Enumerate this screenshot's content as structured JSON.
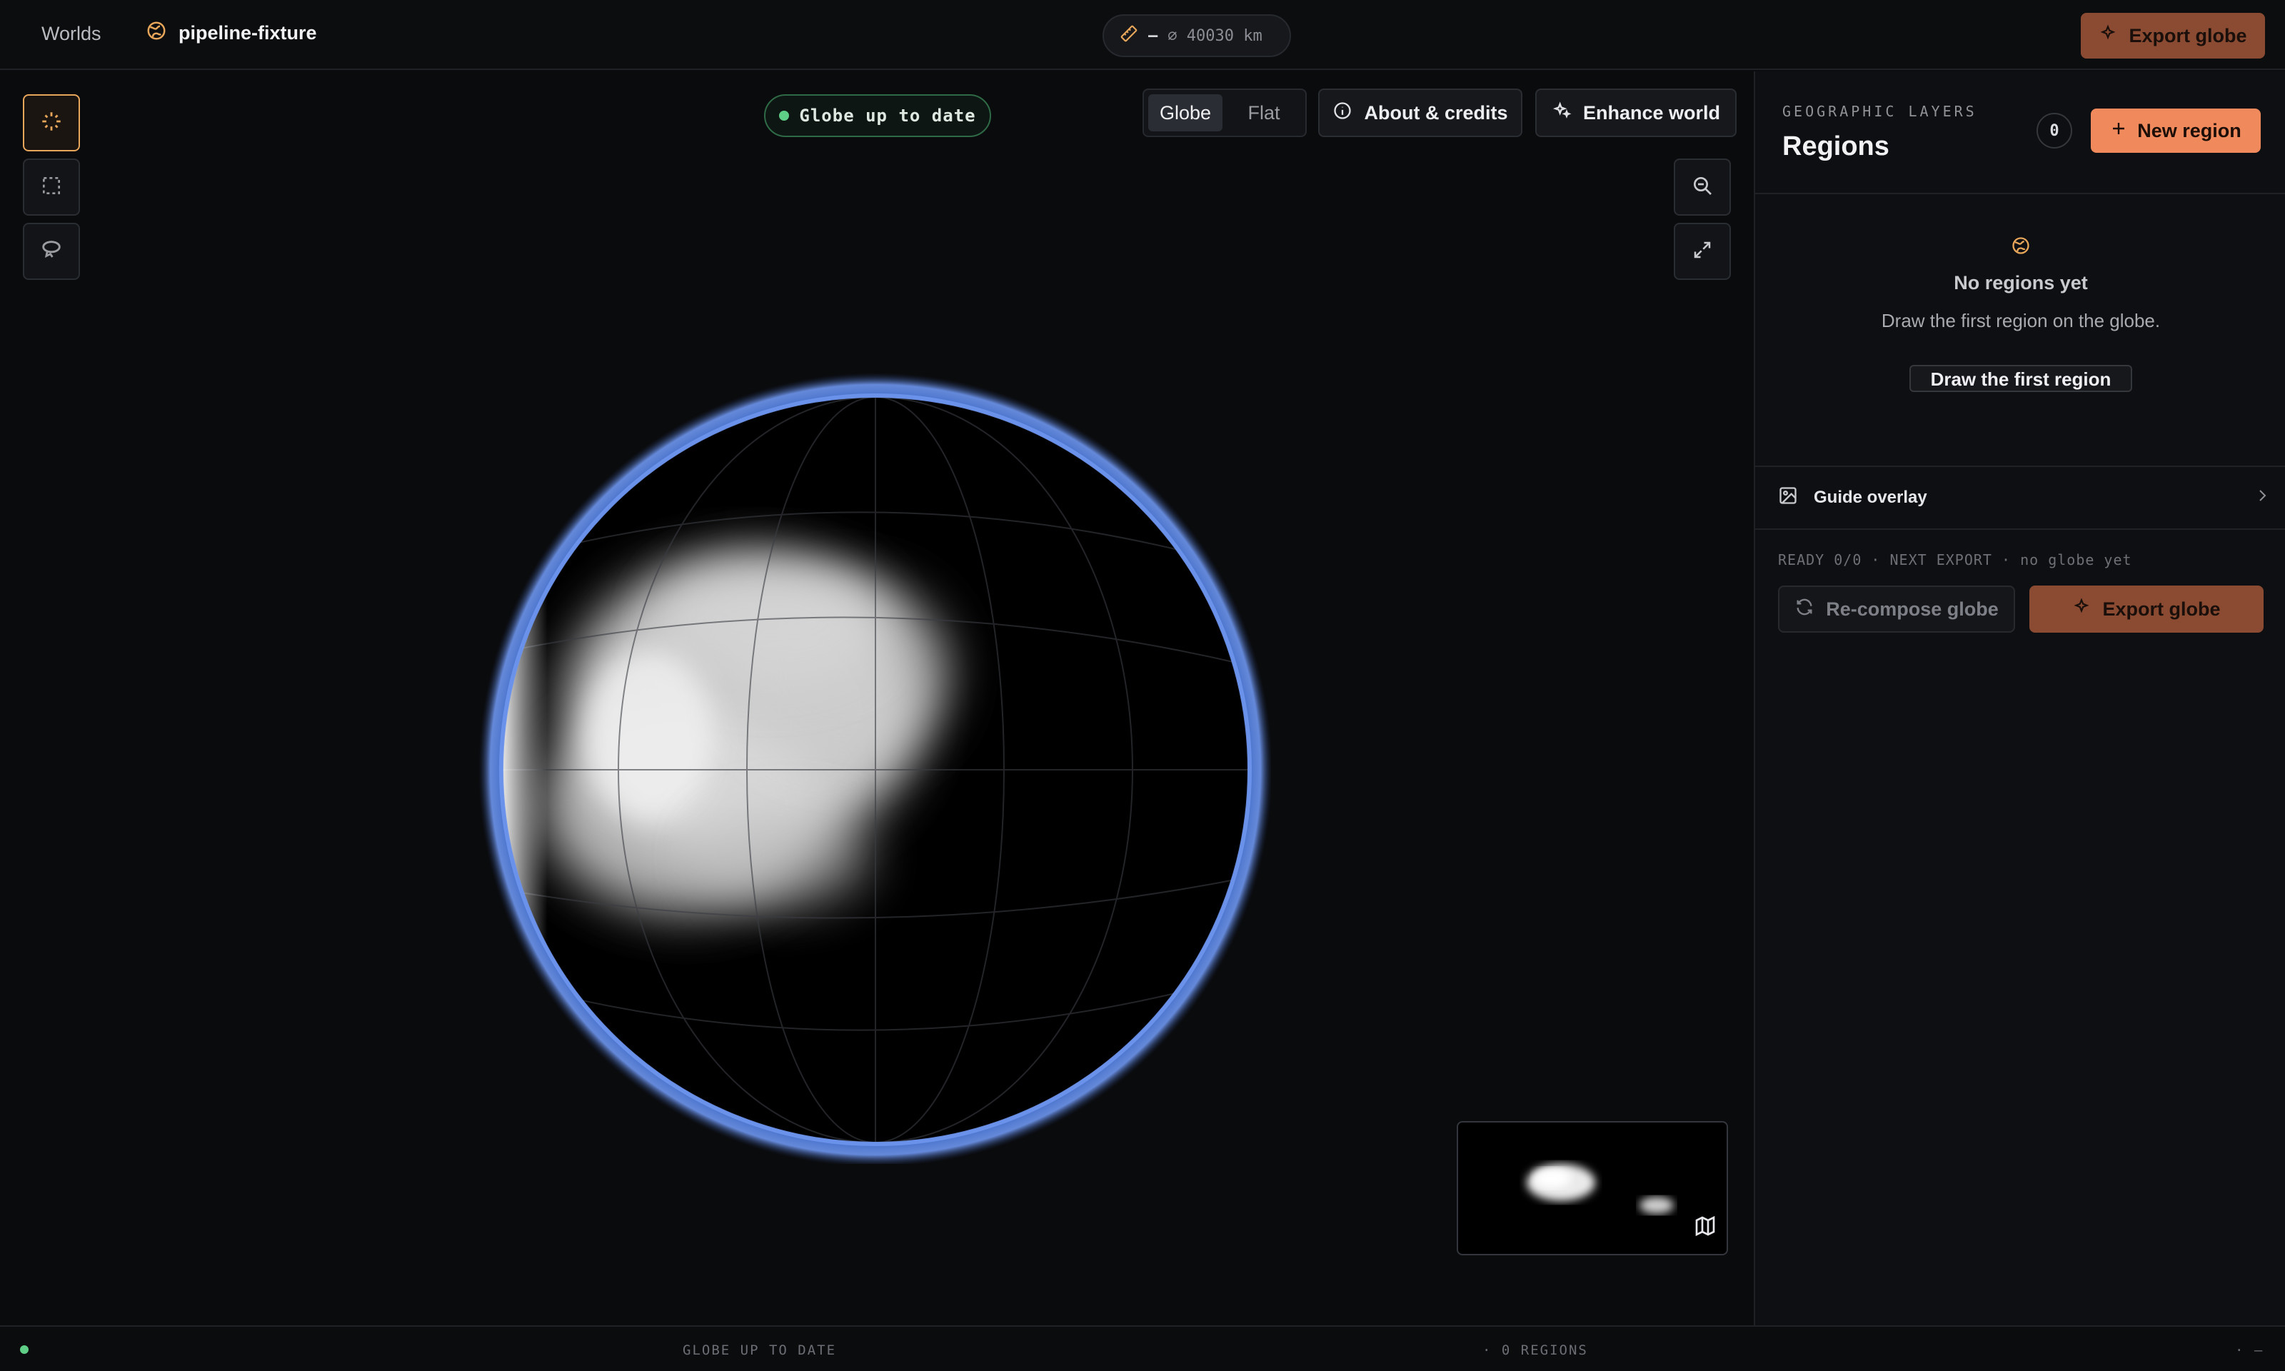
{
  "header": {
    "worlds_link": "Worlds",
    "project_name": "pipeline-fixture",
    "scale_dash": "—",
    "scale_text": "⌀ 40030 km",
    "export_button": "Export globe"
  },
  "canvas": {
    "status": "Globe up to date",
    "view_modes": [
      "Globe",
      "Flat"
    ],
    "active_view": "Globe",
    "about_button": "About & credits",
    "enhance_button": "Enhance world"
  },
  "panel": {
    "eyebrow": "GEOGRAPHIC LAYERS",
    "title": "Regions",
    "count": "0",
    "new_region_button": "New region",
    "empty_title": "No regions yet",
    "empty_subtitle": "Draw the first region on the globe.",
    "draw_button": "Draw the first region",
    "guide_overlay": "Guide overlay",
    "ready_line": "READY 0/0 · NEXT EXPORT · no globe yet",
    "recompose_button": "Re-compose globe",
    "export_button": "Export globe"
  },
  "footer": {
    "status": "GLOBE UP TO DATE",
    "regions": "· 0 REGIONS",
    "end": "· —"
  },
  "colors": {
    "accent": "#f08a5d",
    "accent_muted": "#8a4b32",
    "status_ok": "#5fce86",
    "atmosphere": "#5b86e6",
    "selection": "#e8a65a"
  },
  "icons": [
    "globe-icon",
    "ruler-icon",
    "sparkles-icon",
    "orbit-icon",
    "select-rect-icon",
    "lasso-icon",
    "info-icon",
    "zoom-out-icon",
    "expand-icon",
    "map-icon",
    "plus-icon",
    "image-icon",
    "chevron-right-icon",
    "refresh-icon"
  ]
}
